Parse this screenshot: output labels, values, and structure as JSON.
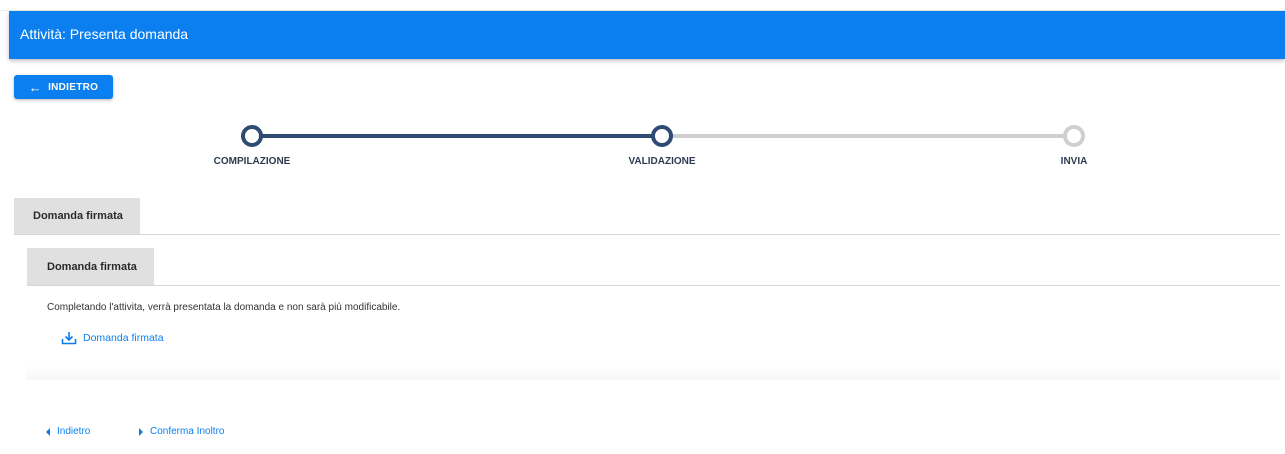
{
  "header": {
    "title": "Attività: Presenta domanda"
  },
  "toolbar": {
    "back_label": "INDIETRO",
    "back_icon": "arrow-left-icon"
  },
  "stepper": {
    "steps": [
      {
        "label": "COMPILAZIONE",
        "state": "completed"
      },
      {
        "label": "VALIDAZIONE",
        "state": "current"
      },
      {
        "label": "INVIA",
        "state": "pending"
      }
    ],
    "colors": {
      "active": "#2e4b73",
      "inactive": "#cfcfcf"
    }
  },
  "tabs": {
    "outer": [
      {
        "label": "Domanda firmata",
        "selected": true
      }
    ],
    "inner": [
      {
        "label": "Domanda firmata",
        "selected": true
      }
    ]
  },
  "content": {
    "notice": "Completando l'attivita, verrà presentata la domanda e non sarà più modificabile.",
    "download_label": "Domanda firmata",
    "download_icon": "download-icon"
  },
  "footer": {
    "back_label": "Indietro",
    "confirm_label": "Conferma Inoltro"
  },
  "colors": {
    "brand": "#0b7ff0",
    "tab_bg": "#e0e0e0"
  }
}
